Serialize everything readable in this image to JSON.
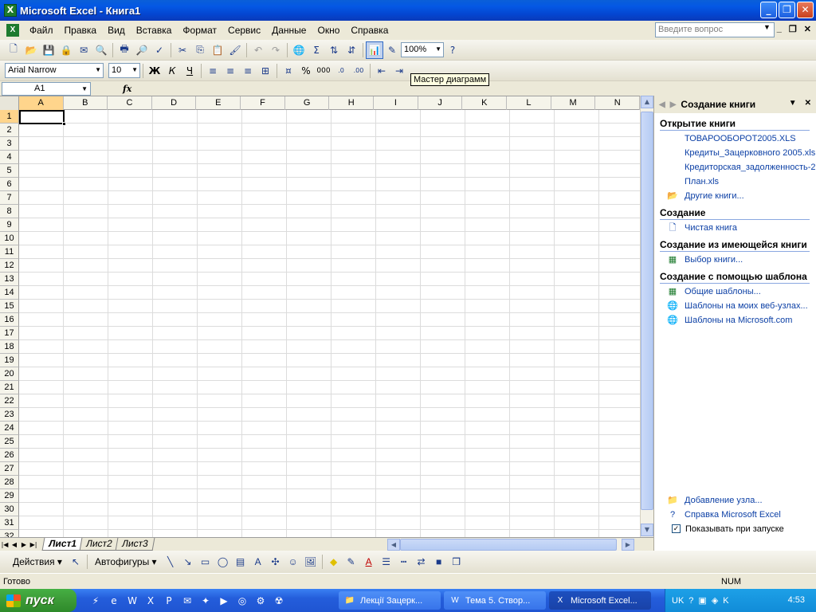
{
  "window": {
    "title": "Microsoft Excel - Книга1",
    "controls": [
      "_",
      "❐",
      "✕"
    ]
  },
  "menu": {
    "items": [
      "Файл",
      "Правка",
      "Вид",
      "Вставка",
      "Формат",
      "Сервис",
      "Данные",
      "Окно",
      "Справка"
    ],
    "ask_placeholder": "Введите вопрос",
    "mdi_controls": [
      "_",
      "❐",
      "✕"
    ]
  },
  "toolbar": {
    "zoom": "100%",
    "font_name": "Arial Narrow",
    "font_size": "10",
    "tooltip": "Мастер диаграмм"
  },
  "formula": {
    "cell_ref": "A1",
    "fx": "fx"
  },
  "sheet": {
    "columns": [
      "A",
      "B",
      "C",
      "D",
      "E",
      "F",
      "G",
      "H",
      "I",
      "J",
      "K",
      "L",
      "M",
      "N"
    ],
    "rows": [
      "1",
      "2",
      "3",
      "4",
      "5",
      "6",
      "7",
      "8",
      "9",
      "10",
      "11",
      "12",
      "13",
      "14",
      "15",
      "16",
      "17",
      "18",
      "19",
      "20",
      "21",
      "22",
      "23",
      "24",
      "25",
      "26",
      "27",
      "28",
      "29",
      "30",
      "31",
      "32"
    ],
    "tabs": [
      "Лист1",
      "Лист2",
      "Лист3"
    ]
  },
  "taskpane": {
    "title": "Создание книги",
    "open_section": "Открытие книги",
    "recent_files": [
      "ТОВАРООБОРОТ2005.XLS",
      "Кредиты_Зацерковного 2005.xls",
      "Кредиторская_задолженность-2",
      "План.xls"
    ],
    "other_books": "Другие книги...",
    "create_section": "Создание",
    "blank_book": "Чистая книга",
    "from_existing_section": "Создание из имеющейся книги",
    "choose_book": "Выбор книги...",
    "template_section": "Создание с помощью шаблона",
    "general_templates": "Общие шаблоны...",
    "web_templates": "Шаблоны на моих веб-узлах...",
    "ms_templates": "Шаблоны на Microsoft.com",
    "add_node": "Добавление узла...",
    "help": "Справка Microsoft Excel",
    "show_at_startup": "Показывать при запуске"
  },
  "drawing": {
    "actions": "Действия",
    "autoshapes": "Автофигуры"
  },
  "status": {
    "text": "Готово",
    "num": "NUM"
  },
  "taskbar": {
    "start": "пуск",
    "tasks": [
      "Лекції Зацерк...",
      "Тема 5. Створ...",
      "Microsoft Excel..."
    ],
    "lang": "UK",
    "clock": "4:53"
  }
}
